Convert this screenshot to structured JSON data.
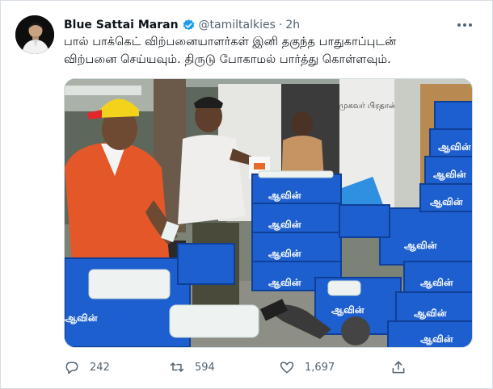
{
  "tweet": {
    "author_name": "Blue Sattai Maran",
    "handle": "@tamiltalkies",
    "separator": "·",
    "time": "2h",
    "text_line1": "பால் பாக்கெட் விற்பனையாளர்கள் இனி தகுந்த பாதுகாப்புடன்",
    "text_line2": "விற்பனை செய்யவும். திருடு போகாமல் பார்த்து கொள்ளவும்.",
    "media_signage": "முகவர் பிரதான்",
    "crate_brand": "ஆவின்"
  },
  "actions": {
    "reply_count": "242",
    "retweet_count": "594",
    "like_count": "1,697"
  },
  "colors": {
    "verified": "#1d9bf0",
    "crate_blue": "#1d5fcf",
    "muted_text": "#536471"
  },
  "icons": [
    "verified-icon",
    "more-icon",
    "reply-icon",
    "retweet-icon",
    "like-icon",
    "share-icon"
  ]
}
